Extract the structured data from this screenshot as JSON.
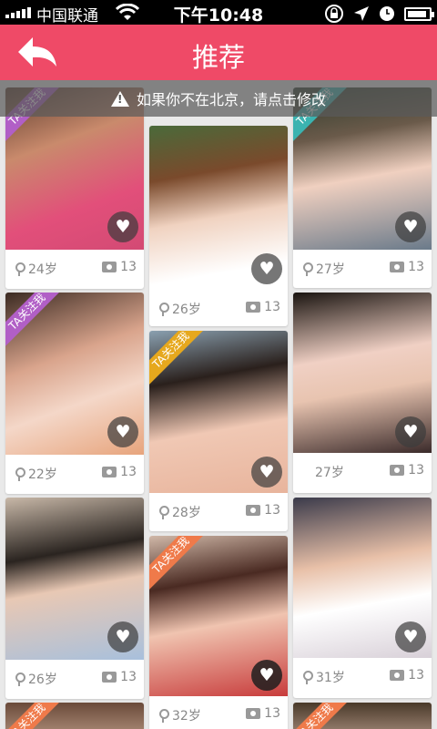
{
  "status_bar": {
    "carrier": "中国联通",
    "time": "下午10:48"
  },
  "header": {
    "title": "推荐"
  },
  "notice": {
    "text": "如果你不在北京，请点击修改"
  },
  "ribbon_label": "TA关注我",
  "cards": [
    {
      "age": "24岁",
      "photos": "13",
      "ribbon": "purple"
    },
    {
      "age": "22岁",
      "photos": "13",
      "ribbon": "purple"
    },
    {
      "age": "26岁",
      "photos": "13",
      "ribbon": ""
    },
    {
      "age": "",
      "photos": "",
      "ribbon": "yellow"
    },
    {
      "age": "26岁",
      "photos": "13",
      "ribbon": ""
    },
    {
      "age": "28岁",
      "photos": "13",
      "ribbon": "yellow"
    },
    {
      "age": "32岁",
      "photos": "13",
      "ribbon": "orange"
    },
    {
      "age": "27岁",
      "photos": "13",
      "ribbon": "teal"
    },
    {
      "age": "27岁",
      "photos": "13",
      "ribbon": ""
    },
    {
      "age": "31岁",
      "photos": "13",
      "ribbon": ""
    },
    {
      "age": "",
      "photos": "",
      "ribbon": "orange"
    }
  ]
}
